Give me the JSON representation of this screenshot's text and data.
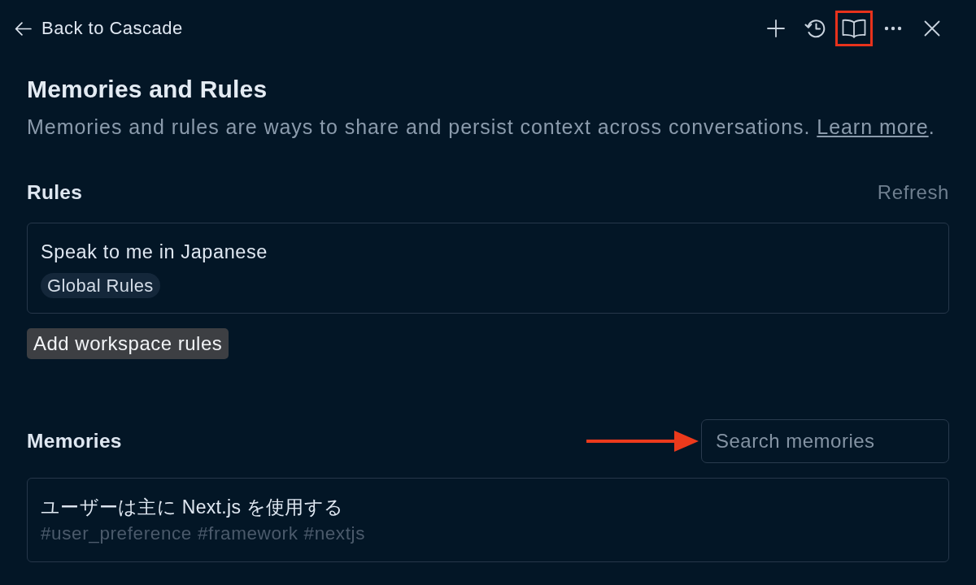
{
  "header": {
    "back_label": "Back to Cascade",
    "toolbar": [
      {
        "kind": "plus",
        "highlighted": false
      },
      {
        "kind": "history",
        "highlighted": false
      },
      {
        "kind": "book",
        "highlighted": true
      },
      {
        "kind": "more",
        "highlighted": false
      },
      {
        "kind": "close",
        "highlighted": false
      }
    ]
  },
  "page": {
    "title": "Memories and Rules",
    "description": "Memories and rules are ways to share and persist context across conversations.",
    "learn_more_link": "Learn more",
    "description_end": "."
  },
  "rules": {
    "heading": "Rules",
    "refresh": "Refresh",
    "items": [
      {
        "text": "Speak to me in Japanese",
        "tag": "Global Rules"
      }
    ],
    "add_button": "Add workspace rules"
  },
  "memories": {
    "heading": "Memories",
    "search": {
      "placeholder": "Search memories",
      "pointed_at": true
    },
    "items": [
      {
        "text": "ユーザーは主に Next.js を使用する",
        "tags": [
          "#user_preference",
          "#framework",
          "#nextjs"
        ]
      }
    ]
  }
}
